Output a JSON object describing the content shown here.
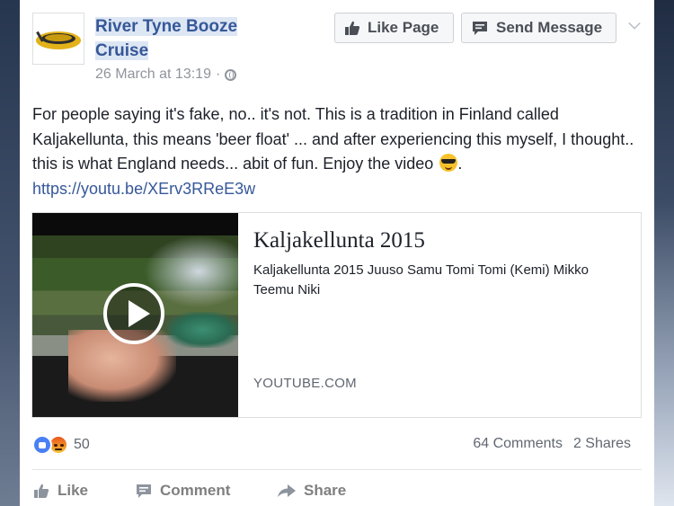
{
  "post": {
    "page_name": "River Tyne Booze Cruise",
    "timestamp": "26 March at 13:19",
    "meta_sep": "·",
    "privacy_icon": "globe-icon",
    "buttons": {
      "like_page": "Like Page",
      "send_message": "Send Message"
    },
    "text": "For people saying it's fake, no.. it's not. This is a tradition in Finland called Kaljakellunta, this means 'beer float' ... and after experiencing this myself, I thought.. this is what England needs... abit of fun. Enjoy the video",
    "text_end": ".",
    "link": "https://youtu.be/XErv3RReE3w"
  },
  "attachment": {
    "title": "Kaljakellunta 2015",
    "description": "Kaljakellunta 2015 Juuso Samu Tomi Tomi (Kemi) Mikko Teemu Niki",
    "domain": "YOUTUBE.COM"
  },
  "stats": {
    "reaction_count": "50",
    "comments": "64 Comments",
    "shares": "2 Shares"
  },
  "actions": {
    "like": "Like",
    "comment": "Comment",
    "share": "Share"
  },
  "colors": {
    "link_blue": "#365899",
    "text": "#1d2129",
    "muted": "#90949c",
    "like_reaction": "#4a80f5"
  }
}
